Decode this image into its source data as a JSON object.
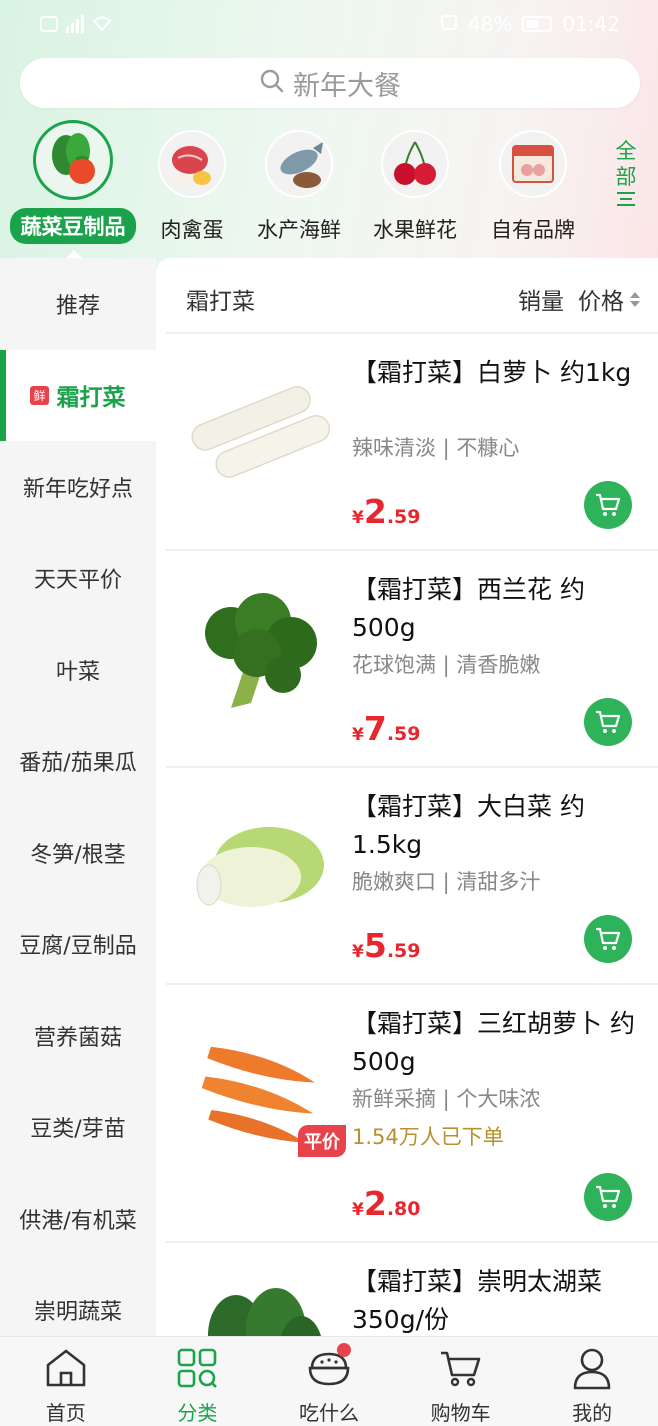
{
  "status_bar": {
    "battery": "48%",
    "time": "01:42"
  },
  "search": {
    "placeholder": "新年大餐"
  },
  "categories": [
    {
      "label": "蔬菜豆制品",
      "icon": "vegetables-icon"
    },
    {
      "label": "肉禽蛋",
      "icon": "meat-icon"
    },
    {
      "label": "水产海鲜",
      "icon": "fish-icon"
    },
    {
      "label": "水果鲜花",
      "icon": "cherry-icon"
    },
    {
      "label": "自有品牌",
      "icon": "brand-product-icon"
    }
  ],
  "all_button": {
    "label": "全部"
  },
  "sidebar": {
    "items": [
      {
        "label": "推荐"
      },
      {
        "label": "霜打菜",
        "badge": "鲜"
      },
      {
        "label": "新年吃好点"
      },
      {
        "label": "天天平价"
      },
      {
        "label": "叶菜"
      },
      {
        "label": "番茄/茄果瓜"
      },
      {
        "label": "冬笋/根茎"
      },
      {
        "label": "豆腐/豆制品"
      },
      {
        "label": "营养菌菇"
      },
      {
        "label": "豆类/芽苗"
      },
      {
        "label": "供港/有机菜"
      },
      {
        "label": "崇明蔬菜"
      }
    ]
  },
  "content_header": {
    "title": "霜打菜",
    "sort_sales": "销量",
    "sort_price": "价格"
  },
  "products": [
    {
      "title": "【霜打菜】白萝卜 约1kg",
      "subtitle": "辣味清淡 | 不糠心",
      "price_symbol": "¥",
      "price_int": "2",
      "price_dec": ".59",
      "image": "white-radish-image"
    },
    {
      "title": "【霜打菜】西兰花 约500g",
      "subtitle": "花球饱满 | 清香脆嫩",
      "price_symbol": "¥",
      "price_int": "7",
      "price_dec": ".59",
      "image": "broccoli-image"
    },
    {
      "title": "【霜打菜】大白菜 约1.5kg",
      "subtitle": "脆嫩爽口 | 清甜多汁",
      "price_symbol": "¥",
      "price_int": "5",
      "price_dec": ".59",
      "image": "napa-cabbage-image"
    },
    {
      "title": "【霜打菜】三红胡萝卜 约500g",
      "subtitle": "新鲜采摘 | 个大味浓",
      "hot": "1.54万人已下单",
      "tag": "平价",
      "price_symbol": "¥",
      "price_int": "2",
      "price_dec": ".80",
      "image": "carrot-image"
    },
    {
      "title": "【霜打菜】崇明太湖菜 350g/份",
      "subtitle": "",
      "image": "leafy-greens-image"
    }
  ],
  "bottom_nav": [
    {
      "label": "首页",
      "icon": "home-icon"
    },
    {
      "label": "分类",
      "icon": "category-grid-icon"
    },
    {
      "label": "吃什么",
      "icon": "rice-bowl-icon"
    },
    {
      "label": "购物车",
      "icon": "cart-icon"
    },
    {
      "label": "我的",
      "icon": "profile-icon"
    }
  ],
  "colors": {
    "accent": "#1aa34a",
    "price": "#e8262e",
    "cart_button": "#2eb35a",
    "badge": "#e8434a"
  }
}
